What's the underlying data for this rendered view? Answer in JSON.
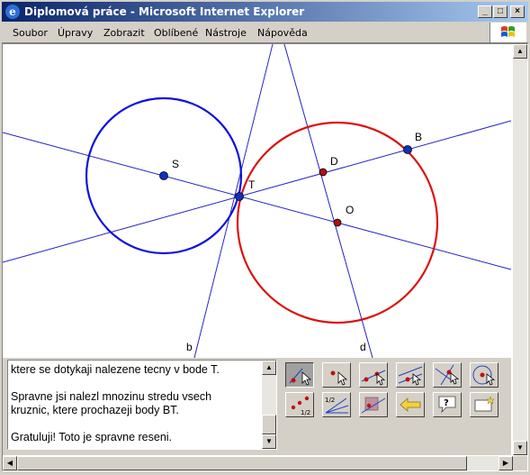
{
  "window": {
    "title": "Diplomová práce - Microsoft Internet Explorer",
    "controls": {
      "minimize": "_",
      "maximize": "□",
      "close": "×"
    }
  },
  "menu": {
    "items": [
      {
        "label": "Soubor"
      },
      {
        "label": "Úpravy"
      },
      {
        "label": "Zobrazit"
      },
      {
        "label": "Oblíbené"
      },
      {
        "label": "Nástroje"
      },
      {
        "label": "Nápověda"
      }
    ]
  },
  "drawing": {
    "colors": {
      "circle_s": "#1010dd",
      "circle_o": "#dd1010",
      "lines": "#2020c8",
      "points_blue": "#1030c0",
      "points_red": "#b01010"
    },
    "labels": {
      "S": "S",
      "T": "T",
      "D": "D",
      "O": "O",
      "B": "B",
      "b": "b",
      "d": "d"
    }
  },
  "text_area": {
    "lines": [
      "ktere se dotykaji nalezene tecny v bode T.",
      "",
      "Spravne jsi nalezl mnozinu stredu vsech",
      "kruznic, ktere prochazeji body BT.",
      "",
      "Gratuluji! Toto je spravne reseni."
    ]
  },
  "toolbar": {
    "tools": [
      {
        "icon": "move-pointer-icon",
        "active": true
      },
      {
        "icon": "new-point-icon"
      },
      {
        "icon": "line-through-points-icon"
      },
      {
        "icon": "parallel-line-icon"
      },
      {
        "icon": "perpendicular-line-icon"
      },
      {
        "icon": "circle-center-point-icon"
      },
      {
        "icon": "midpoint-icon"
      },
      {
        "icon": "angle-bisector-icon"
      },
      {
        "icon": "reflect-about-line-icon"
      },
      {
        "icon": "undo-arrow-icon"
      },
      {
        "icon": "help-icon"
      },
      {
        "icon": "new-construction-icon"
      }
    ]
  }
}
